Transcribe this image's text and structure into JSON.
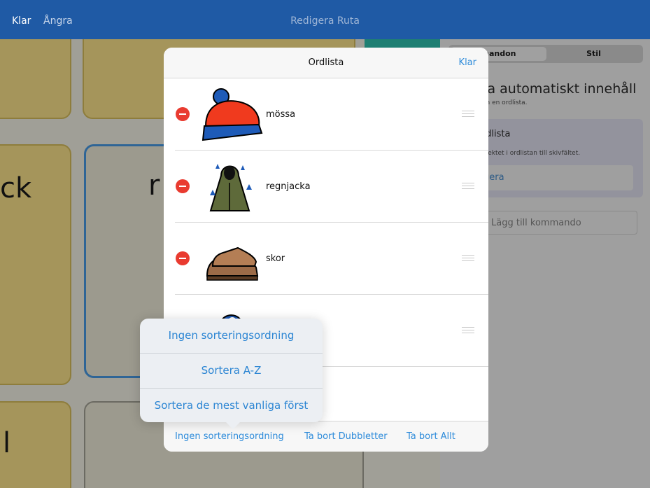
{
  "topbar": {
    "done": "Klar",
    "undo": "Ångra",
    "title": "Redigera Ruta"
  },
  "background": {
    "text_left": "ck",
    "text_mid": "r",
    "text_bottom": "l"
  },
  "right_panel": {
    "tab_commands": "mandon",
    "tab_style": "Stil",
    "heading": "ta automatiskt innehåll",
    "subheading": "ån en ordlista.",
    "box_title": "rdlista",
    "box_desc": "bjektet i ordlistan till skivfältet.",
    "box_button": "gera",
    "add_command": "Lägg till kommando"
  },
  "modal": {
    "title": "Ordlista",
    "done": "Klar",
    "items": [
      {
        "label": "mössa",
        "icon": "winter-hat-icon"
      },
      {
        "label": "regnjacka",
        "icon": "raincoat-icon"
      },
      {
        "label": "skor",
        "icon": "shoes-icon"
      },
      {
        "label": "",
        "icon": "blue-item-icon"
      }
    ],
    "footer": {
      "sort": "Ingen sorteringsordning",
      "remove_duplicates": "Ta bort Dubbletter",
      "remove_all": "Ta bort Allt"
    }
  },
  "sort_popover": {
    "options": [
      "Ingen sorteringsordning",
      "Sortera A-Z",
      "Sortera de mest vanliga först"
    ]
  },
  "colors": {
    "accent": "#2d8bda",
    "topbar": "#1f5aa5",
    "delete": "#e93b30"
  }
}
